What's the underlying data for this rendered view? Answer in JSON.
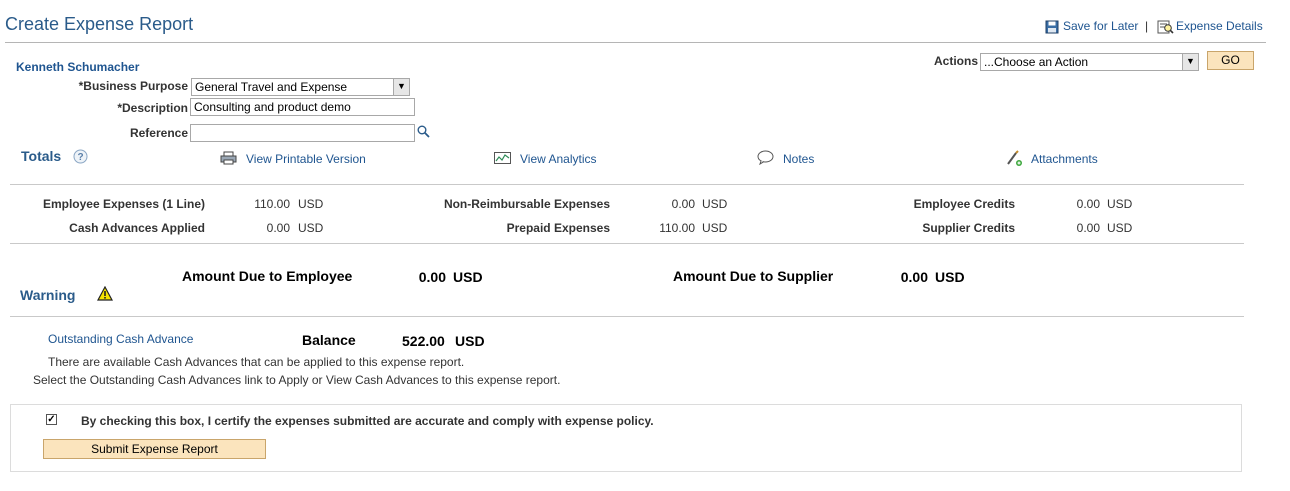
{
  "header": {
    "title": "Create Expense Report",
    "save_for_later": "Save for Later",
    "separator": "|",
    "expense_details": "Expense Details"
  },
  "employee": {
    "name": "Kenneth Schumacher"
  },
  "form": {
    "business_purpose_label": "*Business Purpose",
    "business_purpose_value": "General Travel and Expense",
    "description_label": "*Description",
    "description_value": "Consulting and product demo",
    "reference_label": "Reference",
    "reference_value": ""
  },
  "actions": {
    "label": "Actions",
    "selected": "...Choose an Action",
    "go_label": "GO"
  },
  "totals": {
    "heading": "Totals",
    "links": {
      "printable": "View Printable Version",
      "analytics": "View Analytics",
      "notes": "Notes",
      "attachments": "Attachments"
    },
    "rows": {
      "employee_expenses_label": "Employee Expenses (1 Line)",
      "employee_expenses_amount": "110.00",
      "cash_advances_applied_label": "Cash Advances Applied",
      "cash_advances_applied_amount": "0.00",
      "non_reimbursable_label": "Non-Reimbursable Expenses",
      "non_reimbursable_amount": "0.00",
      "prepaid_label": "Prepaid Expenses",
      "prepaid_amount": "110.00",
      "employee_credits_label": "Employee Credits",
      "employee_credits_amount": "0.00",
      "supplier_credits_label": "Supplier Credits",
      "supplier_credits_amount": "0.00",
      "currency": "USD"
    },
    "amount_due_employee_label": "Amount Due to Employee",
    "amount_due_employee_value": "0.00",
    "amount_due_supplier_label": "Amount Due to Supplier",
    "amount_due_supplier_value": "0.00"
  },
  "warning": {
    "heading": "Warning",
    "link": "Outstanding Cash Advance",
    "balance_label": "Balance",
    "balance_value": "522.00",
    "message_1": "There are available Cash Advances that can be applied to this expense report.",
    "message_2": "Select the Outstanding Cash Advances link to Apply or View Cash Advances to this expense report."
  },
  "certify": {
    "checked": true,
    "text": "By checking this box, I certify the expenses submitted are accurate and comply with expense policy.",
    "submit_label": "Submit Expense Report"
  },
  "colors": {
    "title_blue": "#2a5b8a",
    "link_blue": "#1f5590",
    "button_fill": "#fbe4bd",
    "warning_yellow": "#f5e400"
  }
}
